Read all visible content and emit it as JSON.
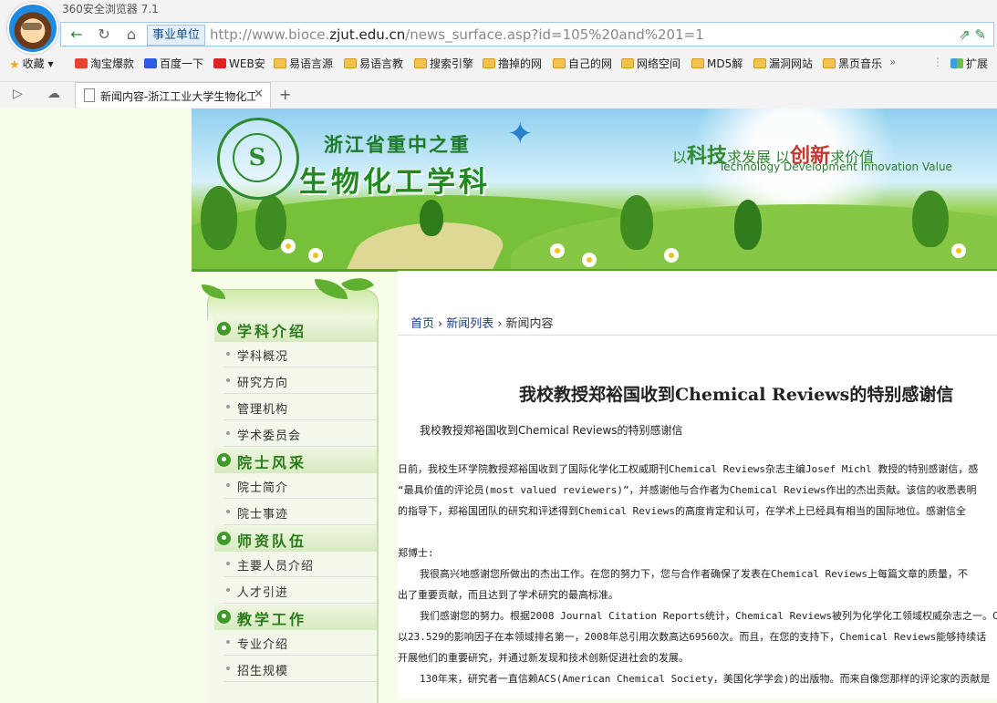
{
  "browser": {
    "app_title": "360安全浏览器 7.1",
    "badge": "事业单位",
    "url_prefix": "http://www.bioce.",
    "url_domain": "zjut.edu.cn",
    "url_suffix": "/news_surface.asp?id=105%20and%201=1",
    "bookmarks": [
      "收藏",
      "淘宝爆款",
      "百度一下",
      "WEB安",
      "易语言源",
      "易语言教",
      "搜索引擎",
      "撸掉的网",
      "自己的网",
      "网络空间",
      "MD5解",
      "漏洞网站",
      "黑页音乐"
    ],
    "extensions_label": "扩展",
    "tab_title": "新闻内容-浙江工业大学生物化工",
    "new_tab": "+"
  },
  "banner": {
    "seal_glyph": "S",
    "subtitle": "浙江省重中之重",
    "title": "生物化工学科",
    "slogan_1": "以",
    "slogan_2": "科技",
    "slogan_3": "求发展 以",
    "slogan_4": "创新",
    "slogan_5": "求价值",
    "slogan_en": "Technology Development Innovation Value"
  },
  "sidebar": {
    "sections": [
      {
        "title": "学科介绍",
        "items": [
          "学科概况",
          "研究方向",
          "管理机构",
          "学术委员会"
        ]
      },
      {
        "title": "院士风采",
        "items": [
          "院士简介",
          "院士事迹"
        ]
      },
      {
        "title": "师资队伍",
        "items": [
          "主要人员介绍",
          "人才引进"
        ]
      },
      {
        "title": "教学工作",
        "items": [
          "专业介绍",
          "招生规模"
        ]
      }
    ]
  },
  "breadcrumb": {
    "home": "首页",
    "list": "新闻列表",
    "current": "新闻内容"
  },
  "article": {
    "title": "我校教授郑裕国收到Chemical Reviews的特别感谢信",
    "lead": "我校教授郑裕国收到Chemical Reviews的特别感谢信",
    "p1_l1": "日前，我校生环学院教授郑裕国收到了国际化学化工权威期刊Chemical Reviews杂志主编Josef Michl 教授的特别感谢信，感",
    "p1_l2": "“最具价值的评论员(most   valued   reviewers)”，并感谢他与合作者为Chemical Reviews作出的杰出贡献。该信的收悉表明",
    "p1_l3": "的指导下，郑裕国团队的研究和评述得到Chemical Reviews的高度肯定和认可，在学术上已经具有相当的国际地位。感谢信全",
    "salutation": "郑博士:",
    "p2_l1": "我很高兴地感谢您所做出的杰出工作。在您的努力下，您与合作者确保了发表在Chemical Reviews上每篇文章的质量，不",
    "p2_l2": "出了重要贡献，而且达到了学术研究的最高标准。",
    "p3_l1": "我们感谢您的努力。根据2008 Journal Citation Reports统计，Chemical Reviews被列为化学化工领域权威杂志之一。C",
    "p3_l2": "以23.529的影响因子在本领域排名第一，2008年总引用次数高达69560次。而且，在您的支持下，Chemical Reviews能够持续话",
    "p3_l3": "开展他们的重要研究，并通过新发现和技术创新促进社会的发展。",
    "p4_l1": "130年来，研究者一直信赖ACS(American Chemical Society，美国化学学会)的出版物。而来自像您那样的评论家的贡献是"
  }
}
